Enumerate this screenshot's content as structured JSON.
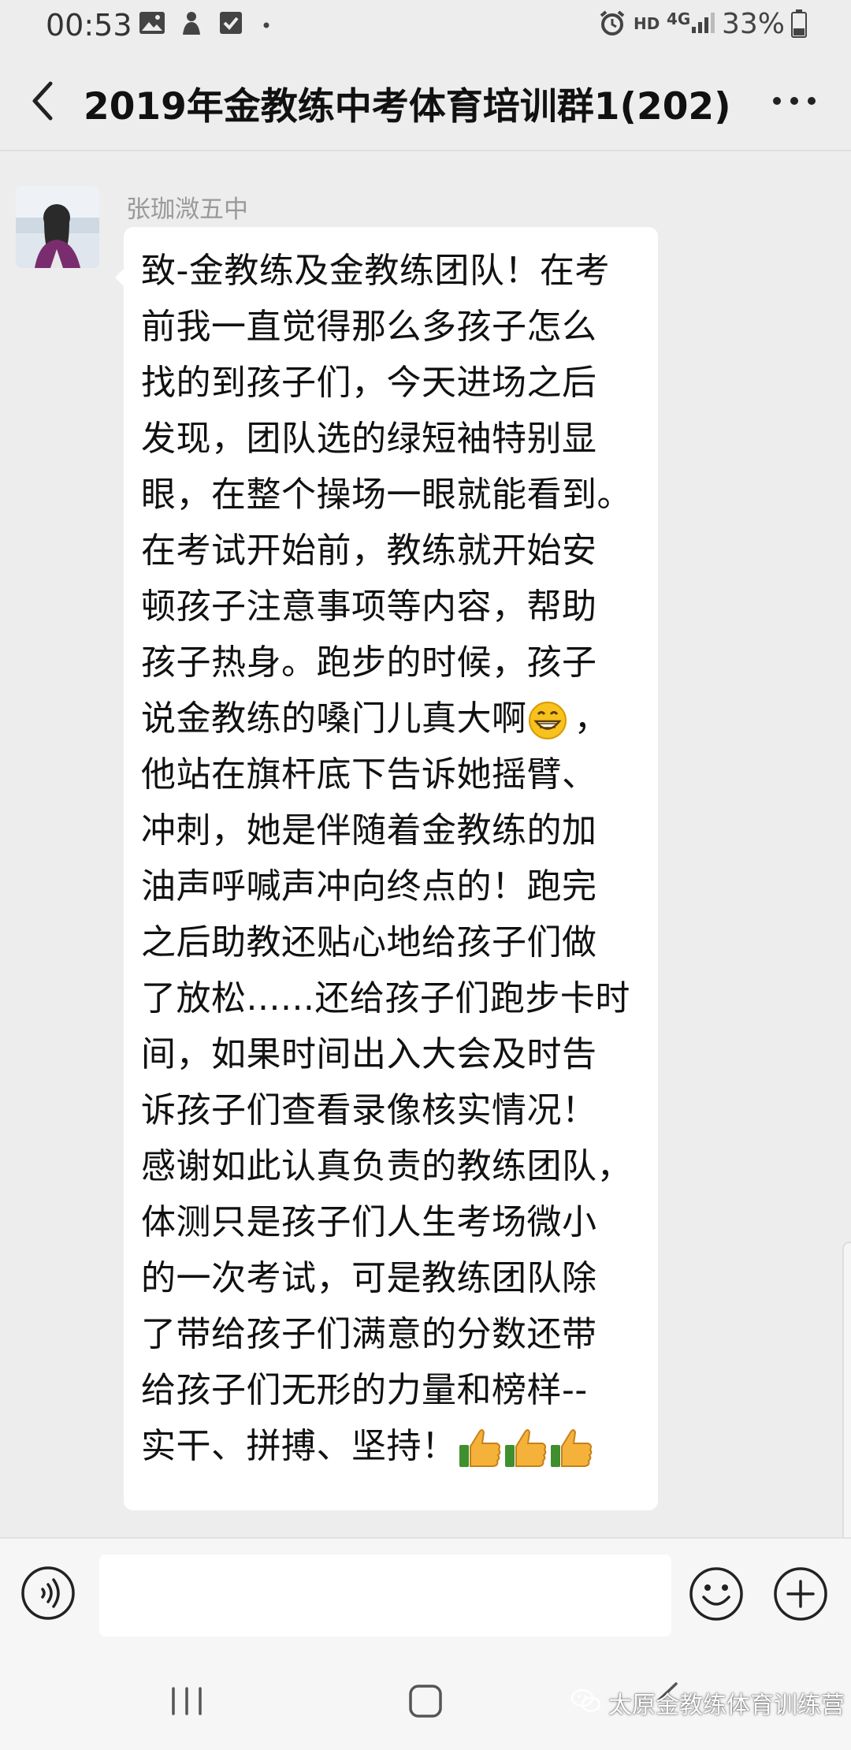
{
  "status_bar": {
    "time": "00:53",
    "hd": "HD",
    "network": "4G",
    "battery": "33%"
  },
  "header": {
    "title": "2019年金教练中考体育培训群1(202)"
  },
  "message": {
    "sender": "张珈溦五中",
    "lines": [
      "致-金教练及金教练团队！在考",
      "前我一直觉得那么多孩子怎么",
      "找的到孩子们，今天进场之后",
      "发现，团队选的绿短袖特别显",
      "眼，在整个操场一眼就能看到。",
      "在考试开始前，教练就开始安",
      "顿孩子注意事项等内容，帮助",
      "孩子热身。跑步的时候，孩子",
      "说金教练的嗓门儿真大啊",
      "他站在旗杆底下告诉她摇臂、",
      "冲刺，她是伴随着金教练的加",
      "油声呼喊声冲向终点的！跑完",
      "之后助教还贴心地给孩子们做",
      "了放松......还给孩子们跑步卡时",
      "间，如果时间出入大会及时告",
      "诉孩子们查看录像核实情况！",
      "感谢如此认真负责的教练团队，",
      "体测只是孩子们人生考场微小",
      "的一次考试，可是教练团队除",
      "了带给孩子们满意的分数还带",
      "给孩子们无形的力量和榜样--",
      "实干、拼搏、坚持！"
    ],
    "line9_suffix": "，"
  },
  "input": {
    "placeholder": ""
  },
  "watermark": "太原金教练体育训练营",
  "colors": {
    "background": "#ededed",
    "bubble": "#ffffff",
    "sender_name": "#999999"
  }
}
